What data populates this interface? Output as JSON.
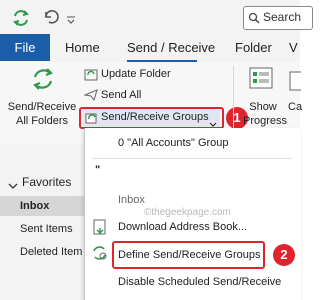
{
  "search": {
    "label": "Search"
  },
  "tabs": {
    "file": "File",
    "home": "Home",
    "send_receive": "Send / Receive",
    "folder": "Folder",
    "view": "V"
  },
  "ribbon": {
    "send_receive_all": {
      "line1": "Send/Receive",
      "line2": "All Folders"
    },
    "update_folder": "Update Folder",
    "send_all": "Send All",
    "send_receive_groups": "Send/Receive Groups",
    "show_progress": {
      "line1": "Show",
      "line2": "Progress"
    },
    "cancel_all": "Ca"
  },
  "nav": {
    "favorites": "Favorites",
    "inbox": "Inbox",
    "sent_items": "Sent Items",
    "deleted_items": "Deleted Item"
  },
  "menu": {
    "all_accounts_group": "0 \"All Accounts\" Group",
    "quote": "\"",
    "inbox": "Inbox",
    "download_address_book": "Download Address Book...",
    "define_groups": "Define Send/Receive Groups",
    "disable_scheduled": "Disable Scheduled Send/Receive"
  },
  "callouts": {
    "one": "1",
    "two": "2"
  },
  "watermark": "©thegeekpage.com",
  "colors": {
    "accent": "#1b5ea8",
    "callout_red": "#e0242e",
    "sync_green": "#2e9a4b"
  }
}
